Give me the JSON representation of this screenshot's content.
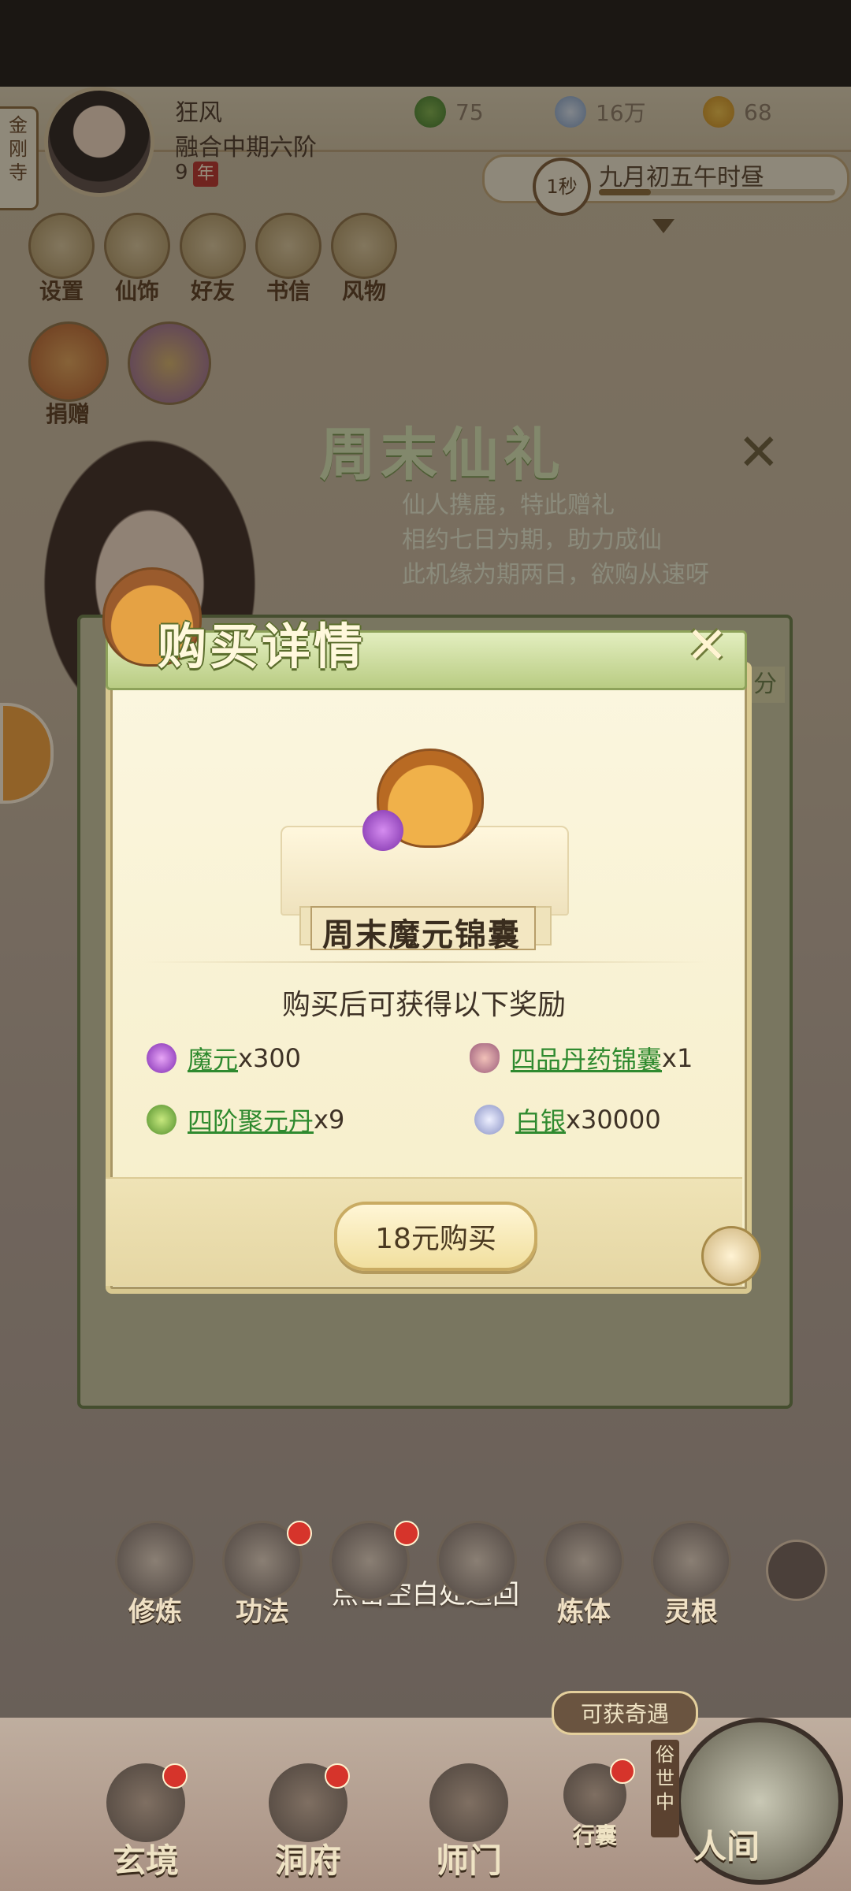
{
  "header": {
    "temple": "金刚寺",
    "player": {
      "name": "狂风",
      "rank": "融合中期六阶",
      "age": "9",
      "age_unit": "年"
    },
    "resources": [
      {
        "icon": "leaf-icon",
        "value": "75"
      },
      {
        "icon": "coin-icon",
        "value": "16万"
      },
      {
        "icon": "power-icon",
        "value": "68"
      }
    ],
    "time": {
      "speed": "1秒",
      "date": "九月初五午时昼",
      "progress": 0.22
    }
  },
  "functions": [
    {
      "label": "设置",
      "icon": "settings-icon"
    },
    {
      "label": "仙饰",
      "icon": "costume-icon"
    },
    {
      "label": "好友",
      "icon": "friends-icon"
    },
    {
      "label": "书信",
      "icon": "letter-icon"
    },
    {
      "label": "风物",
      "icon": "scenery-icon"
    }
  ],
  "donate": {
    "label": "捐赠"
  },
  "event": {
    "title": "周末仙礼",
    "lines": [
      "仙人携鹿，特此赠礼",
      "相约七日为期，助力成仙",
      "此机缘为期两日，欲购从速呀"
    ],
    "side_tag": "分"
  },
  "modal": {
    "title": "购买详情",
    "item_name": "周末魔元锦囊",
    "rewards_heading": "购买后可获得以下奖励",
    "rewards": [
      {
        "name": "魔元",
        "qty": "x300",
        "icon": "moyuan-gem-icon"
      },
      {
        "name": "四品丹药锦囊",
        "qty": "x1",
        "icon": "pill-pouch-icon"
      },
      {
        "name": "四阶聚元丹",
        "qty": "x9",
        "icon": "juyuan-pill-icon"
      },
      {
        "name": "白银",
        "qty": "x30000",
        "icon": "silver-icon"
      }
    ],
    "buy_label": "18元购买"
  },
  "back_hint": "点击空白处返回",
  "skills": [
    "修炼",
    "功法",
    "",
    "",
    "炼体",
    "灵根"
  ],
  "qiyu": "可获奇遇",
  "nav": [
    {
      "label": "玄境"
    },
    {
      "label": "洞府"
    },
    {
      "label": "师门"
    },
    {
      "label": "行囊"
    }
  ],
  "renjian": "人间",
  "suishi": "俗世中"
}
